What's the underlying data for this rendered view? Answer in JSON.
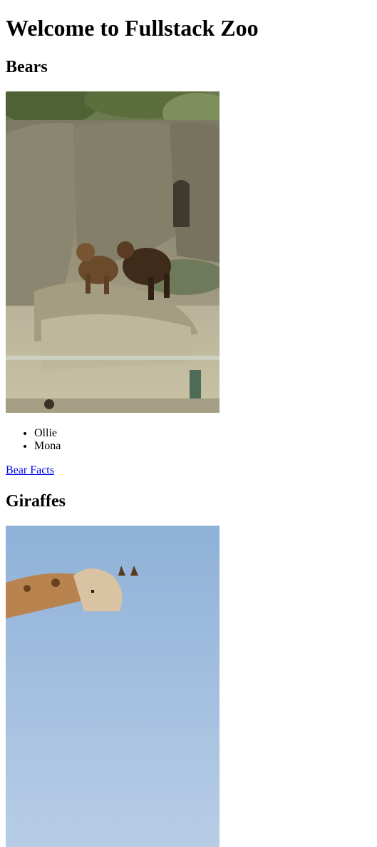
{
  "page": {
    "title": "Welcome to Fullstack Zoo"
  },
  "sections": [
    {
      "heading": "Bears",
      "photo_subject": "brown-bears-on-rocks-photo",
      "animals": [
        "Ollie",
        "Mona"
      ],
      "link_label": "Bear Facts"
    },
    {
      "heading": "Giraffes",
      "photo_subject": "giraffes-photo"
    }
  ],
  "colors": {
    "link": "#0000ee",
    "text": "#000000",
    "background": "#ffffff"
  }
}
